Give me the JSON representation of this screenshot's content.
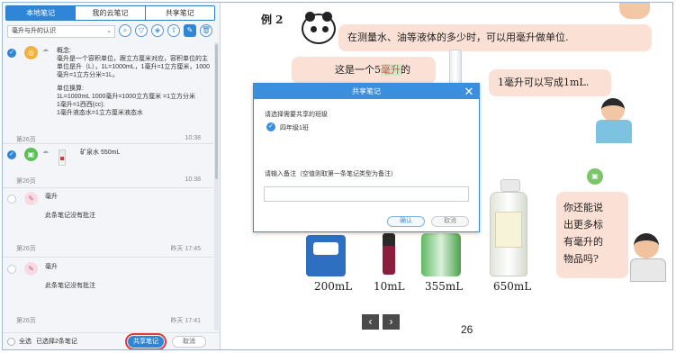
{
  "tabs": [
    "本地笔记",
    "我的云笔记",
    "共享笔记"
  ],
  "filter": {
    "selected": "毫升与升的认识"
  },
  "toolbar_icons": [
    "search-icon",
    "filter-icon",
    "tag-icon",
    "upload-icon",
    "edit-icon",
    "delete-icon"
  ],
  "notes": [
    {
      "checked": true,
      "type": "concept",
      "badge_color": "#f0b23c",
      "body": [
        "概念:",
        "毫升是一个容积单位，跟立方厘米对应，容积单位的主单位是升（L），1L=1000mL，1毫升=1立方厘米，1000毫升=1立方分米=1L。",
        "",
        "单位换算:",
        "1L=1000mL 1000毫升=1000立方厘米 =1立方分米",
        "1毫升=1西西(cc).",
        "1毫升液态水=1立方厘米液态水"
      ],
      "page": "第26页",
      "time": "10:38"
    },
    {
      "checked": true,
      "type": "image",
      "badge_color": "#5cbf5a",
      "body": [
        "矿泉水 550mL"
      ],
      "page": "第26页",
      "time": "10:38"
    },
    {
      "checked": false,
      "type": "annotation",
      "badge_color": "#f3c8d4",
      "body": [
        "毫升",
        "此条笔记没有批注"
      ],
      "page": "第26页",
      "time": "昨天 17:45"
    },
    {
      "checked": false,
      "type": "annotation",
      "badge_color": "#f3c8d4",
      "body": [
        "毫升",
        "此条笔记没有批注"
      ],
      "page": "第26页",
      "time": "昨天 17:41"
    }
  ],
  "bottom": {
    "select_all": "全选",
    "selected_count": "已选择2条笔记",
    "share_button": "共享笔记",
    "cancel_button": "取消"
  },
  "book": {
    "example_title": "例 2",
    "bubble1": "在测量水、油等液体的多少时，可以用毫升做单位.",
    "bubble2_pre": "这是一个5",
    "bubble2_hl": "毫升",
    "bubble2_post": "的",
    "bubble3": "1毫升可以写成1mL.",
    "bubble4": "你还能说\n出更多标\n有毫升的\n物品吗?",
    "captions": [
      "200mL",
      "10mL",
      "355mL",
      "650mL"
    ],
    "page_number": "26"
  },
  "modal": {
    "title": "共享笔记",
    "choose_class_label": "请选择需要共享的班级",
    "class_option": "四年级1班",
    "remark_label": "请输入备注（空值则取第一条笔记类型为备注）",
    "remark_value": "",
    "confirm": "确认",
    "cancel": "取消"
  }
}
